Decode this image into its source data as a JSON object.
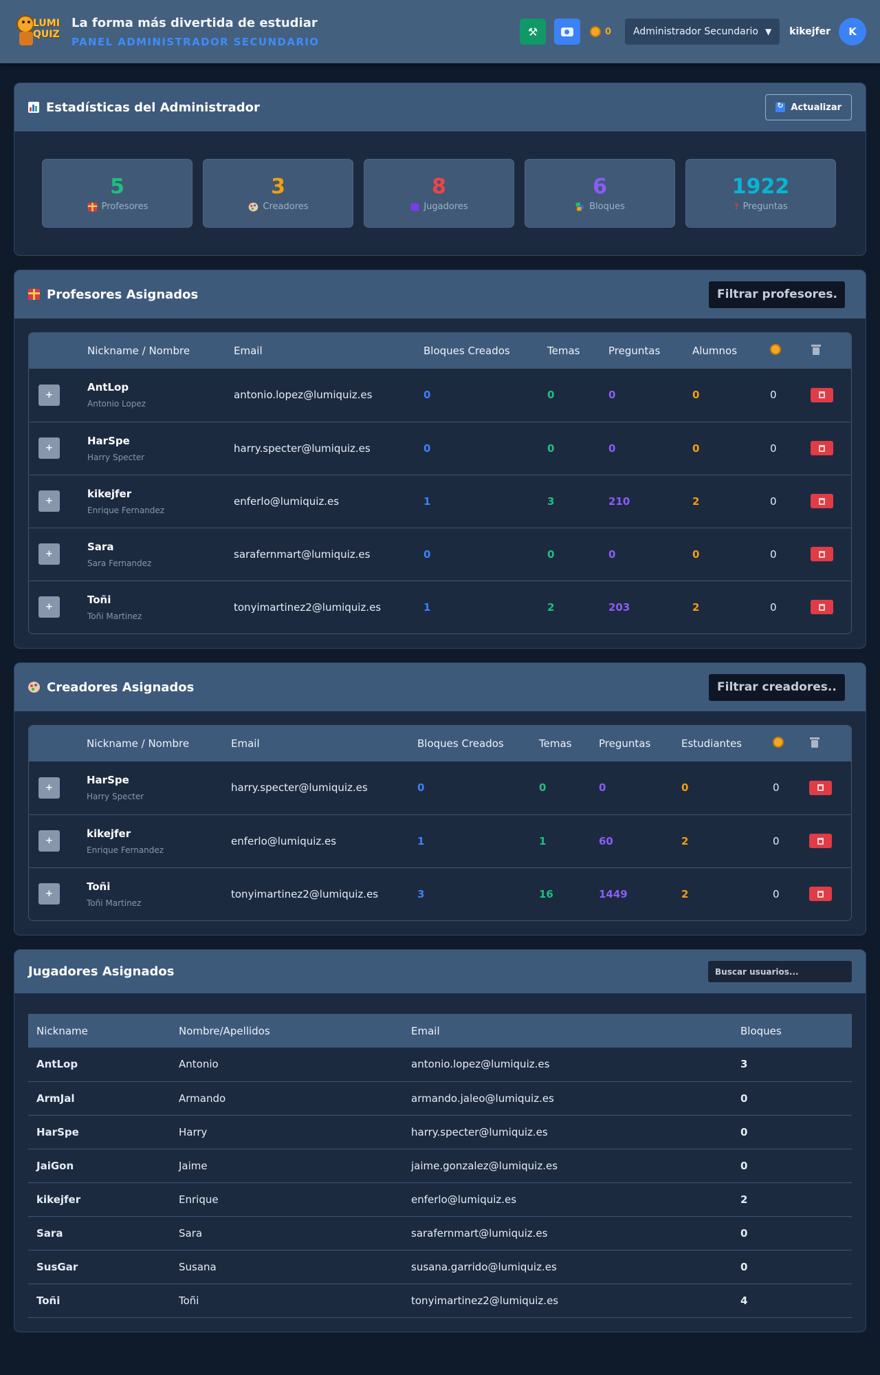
{
  "header": {
    "tagline": "La forma más divertida de estudiar",
    "panel_label": "PANEL ADMINISTRADOR SECUNDARIO",
    "logo_text": "LUMI QUIZ",
    "coins": "0",
    "role_select": "Administrador Secundario",
    "username": "kikejfer",
    "avatar_initial": "K"
  },
  "stats": {
    "title": "Estadísticas del Administrador",
    "refresh_label": "Actualizar",
    "cards": [
      {
        "value": "5",
        "label": "Profesores",
        "color": "#1fbf7f"
      },
      {
        "value": "3",
        "label": "Creadores",
        "color": "#f59e0b"
      },
      {
        "value": "8",
        "label": "Jugadores",
        "color": "#ef4444"
      },
      {
        "value": "6",
        "label": "Bloques",
        "color": "#8b5cf6"
      },
      {
        "value": "1922",
        "label": "Preguntas",
        "color": "#06b6d4"
      }
    ]
  },
  "teachers": {
    "title": "Profesores Asignados",
    "filter_placeholder": "Filtrar profesores...",
    "columns": [
      "Nickname / Nombre",
      "Email",
      "Bloques Creados",
      "Temas",
      "Preguntas",
      "Alumnos"
    ],
    "rows": [
      {
        "nick": "AntLop",
        "name": "Antonio Lopez",
        "email": "antonio.lopez@lumiquiz.es",
        "blocks": "0",
        "topics": "0",
        "questions": "0",
        "students": "0",
        "coins": "0"
      },
      {
        "nick": "HarSpe",
        "name": "Harry Specter",
        "email": "harry.specter@lumiquiz.es",
        "blocks": "0",
        "topics": "0",
        "questions": "0",
        "students": "0",
        "coins": "0"
      },
      {
        "nick": "kikejfer",
        "name": "Enrique Fernandez",
        "email": "enferlo@lumiquiz.es",
        "blocks": "1",
        "topics": "3",
        "questions": "210",
        "students": "2",
        "coins": "0"
      },
      {
        "nick": "Sara",
        "name": "Sara Fernandez",
        "email": "sarafernmart@lumiquiz.es",
        "blocks": "0",
        "topics": "0",
        "questions": "0",
        "students": "0",
        "coins": "0"
      },
      {
        "nick": "Toñi",
        "name": "Toñi Martinez",
        "email": "tonyimartinez2@lumiquiz.es",
        "blocks": "1",
        "topics": "2",
        "questions": "203",
        "students": "2",
        "coins": "0"
      }
    ]
  },
  "creators": {
    "title": "Creadores Asignados",
    "filter_placeholder": "Filtrar creadores...",
    "columns": [
      "Nickname / Nombre",
      "Email",
      "Bloques Creados",
      "Temas",
      "Preguntas",
      "Estudiantes"
    ],
    "rows": [
      {
        "nick": "HarSpe",
        "name": "Harry Specter",
        "email": "harry.specter@lumiquiz.es",
        "blocks": "0",
        "topics": "0",
        "questions": "0",
        "students": "0",
        "coins": "0"
      },
      {
        "nick": "kikejfer",
        "name": "Enrique Fernandez",
        "email": "enferlo@lumiquiz.es",
        "blocks": "1",
        "topics": "1",
        "questions": "60",
        "students": "2",
        "coins": "0"
      },
      {
        "nick": "Toñi",
        "name": "Toñi Martinez",
        "email": "tonyimartinez2@lumiquiz.es",
        "blocks": "3",
        "topics": "16",
        "questions": "1449",
        "students": "2",
        "coins": "0"
      }
    ]
  },
  "players": {
    "title": "Jugadores Asignados",
    "search_placeholder": "Buscar usuarios...",
    "columns": [
      "Nickname",
      "Nombre/Apellidos",
      "Email",
      "Bloques"
    ],
    "rows": [
      {
        "nick": "AntLop",
        "name": "Antonio",
        "email": "antonio.lopez@lumiquiz.es",
        "blocks": "3"
      },
      {
        "nick": "ArmJal",
        "name": "Armando",
        "email": "armando.jaleo@lumiquiz.es",
        "blocks": "0"
      },
      {
        "nick": "HarSpe",
        "name": "Harry",
        "email": "harry.specter@lumiquiz.es",
        "blocks": "0"
      },
      {
        "nick": "JaiGon",
        "name": "Jaime",
        "email": "jaime.gonzalez@lumiquiz.es",
        "blocks": "0"
      },
      {
        "nick": "kikejfer",
        "name": "Enrique",
        "email": "enferlo@lumiquiz.es",
        "blocks": "2"
      },
      {
        "nick": "Sara",
        "name": "Sara",
        "email": "sarafernmart@lumiquiz.es",
        "blocks": "0"
      },
      {
        "nick": "SusGar",
        "name": "Susana",
        "email": "susana.garrido@lumiquiz.es",
        "blocks": "0"
      },
      {
        "nick": "Toñi",
        "name": "Toñi",
        "email": "tonyimartinez2@lumiquiz.es",
        "blocks": "4"
      }
    ]
  }
}
